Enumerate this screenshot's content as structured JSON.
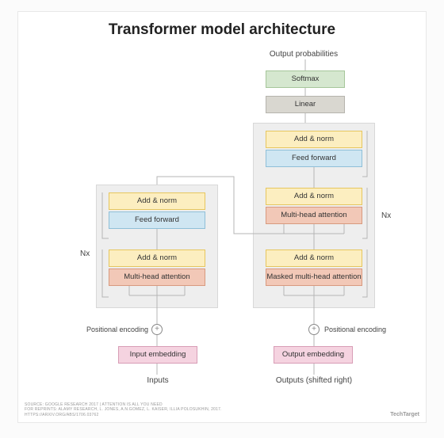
{
  "title": "Transformer model architecture",
  "labels": {
    "output_prob": "Output probabilities",
    "inputs": "Inputs",
    "outputs": "Outputs (shifted right)",
    "nx": "Nx",
    "pos_enc": "Positional encoding"
  },
  "blocks": {
    "softmax": "Softmax",
    "linear": "Linear",
    "add_norm": "Add & norm",
    "feed_forward": "Feed forward",
    "multi_head": "Multi-head attention",
    "masked_multi_head": "Masked multi-head attention",
    "input_emb": "Input embedding",
    "output_emb": "Output embedding"
  },
  "footer": {
    "line1": "SOURCE: GOOGLE RESEARCH 2017 | ATTENTION IS ALL YOU NEED",
    "line2": "FOR REPRINTS: ALAMY RESEARCH, L. JONES, A.N.GOMEZ, L. KAISER, ILLIA POLOSUKHIN, 2017.",
    "line3": "HTTPS://ARXIV.ORG/ABS/1706.03762"
  },
  "brand": "TechTarget"
}
